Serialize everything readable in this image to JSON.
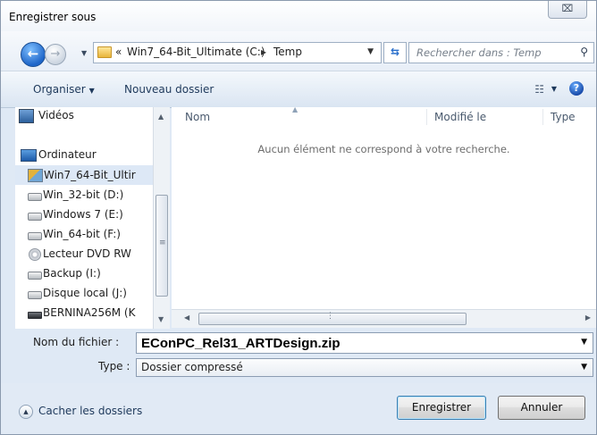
{
  "window": {
    "title": "Enregistrer sous",
    "close_glyph": "⌧"
  },
  "nav": {
    "back_glyph": "←",
    "forward_glyph": "→",
    "breadcrumb_prefix": "«",
    "breadcrumb": [
      "Win7_64-Bit_Ultimate (C:)",
      "Temp"
    ],
    "crumb_separator": "▸",
    "refresh_glyph": "⇆",
    "search_placeholder": "Rechercher dans : Temp"
  },
  "toolbar": {
    "organize": "Organiser",
    "new_folder": "Nouveau dossier"
  },
  "sidebar": {
    "items": [
      {
        "label": "Vidéos",
        "icon": "video-library-icon"
      },
      {
        "label": "Ordinateur",
        "icon": "computer-icon"
      },
      {
        "label": "Win7_64-Bit_Ultir",
        "icon": "system-drive-icon",
        "selected": true
      },
      {
        "label": "Win_32-bit (D:)",
        "icon": "drive-icon"
      },
      {
        "label": "Windows 7 (E:)",
        "icon": "drive-icon"
      },
      {
        "label": "Win_64-bit (F:)",
        "icon": "drive-icon"
      },
      {
        "label": "Lecteur DVD RW",
        "icon": "dvd-drive-icon"
      },
      {
        "label": "Backup (I:)",
        "icon": "drive-icon"
      },
      {
        "label": "Disque local (J:)",
        "icon": "drive-icon"
      },
      {
        "label": "BERNINA256M (K",
        "icon": "removable-drive-icon"
      }
    ]
  },
  "filelist": {
    "columns": [
      "Nom",
      "Modifié le",
      "Type"
    ],
    "empty_message": "Aucun élément ne correspond à votre recherche."
  },
  "form": {
    "filename_label": "Nom du fichier :",
    "filename_value": "EConPC_Rel31_ARTDesign.zip",
    "type_label": "Type :",
    "type_value": "Dossier compressé"
  },
  "footer": {
    "hide_folders": "Cacher les dossiers",
    "save": "Enregistrer",
    "cancel": "Annuler"
  },
  "colors": {
    "accent": "#1f66c9",
    "window_bg": "#dfe9f5",
    "selection": "#dde8f6"
  }
}
